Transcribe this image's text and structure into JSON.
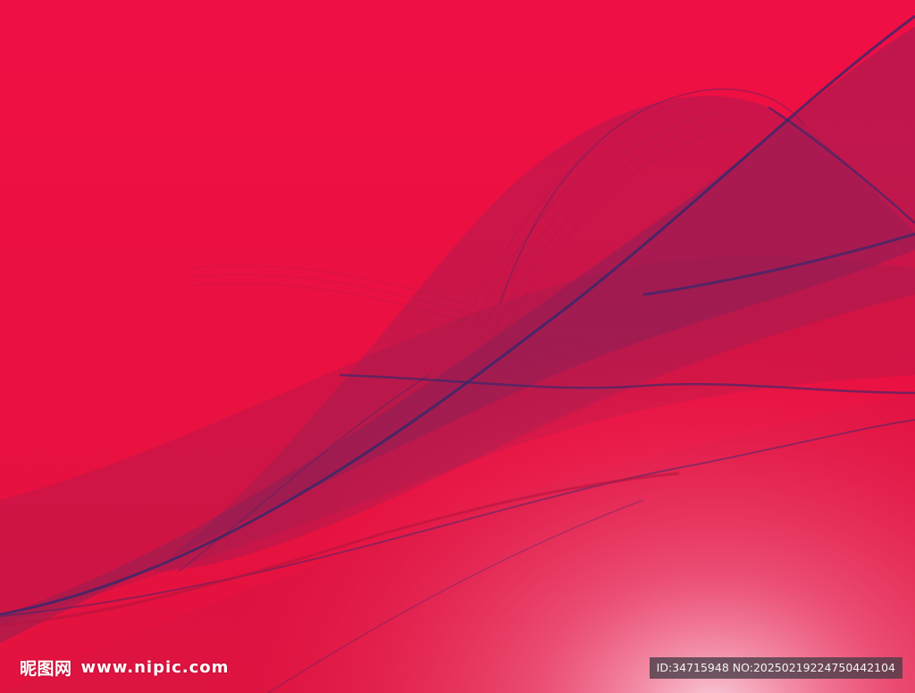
{
  "watermark": {
    "brand_cn": "昵图网",
    "url": "www.nipic.com"
  },
  "image_id": {
    "text": "ID:34715948 NO:20250219224750442104"
  },
  "colors": {
    "base_red": "#e8103f",
    "wave_navy": "#2b2a6e",
    "glow_pink": "#f7b4c8"
  }
}
